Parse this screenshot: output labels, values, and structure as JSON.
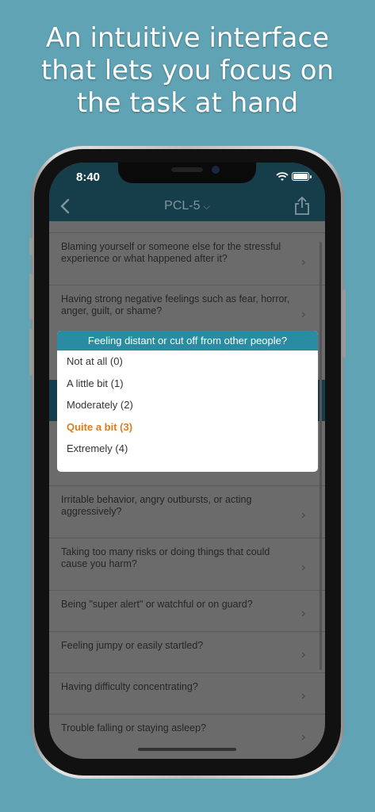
{
  "headline": "An intuitive interface that lets you focus on the task at hand",
  "status_bar": {
    "time": "8:40"
  },
  "nav": {
    "title": "PCL-5",
    "title_chevron": "⌵"
  },
  "list_items": [
    "Blaming yourself or someone else for the stressful experience or what happened after it?",
    "Having strong negative feelings such as fear, horror, anger, guilt, or shame?",
    "Irritable behavior, angry outbursts, or acting aggressively?",
    "Taking too many risks or doing things that could cause you harm?",
    "Being \"super alert\" or watchful or on guard?",
    "Feeling jumpy or easily startled?",
    "Having difficulty concentrating?",
    "Trouble falling or staying asleep?"
  ],
  "modal": {
    "question": "Feeling distant or cut off from other people?",
    "options": [
      {
        "label": "Not at all (0)",
        "selected": false
      },
      {
        "label": "A little bit (1)",
        "selected": false
      },
      {
        "label": "Moderately (2)",
        "selected": false
      },
      {
        "label": "Quite a bit (3)",
        "selected": true
      },
      {
        "label": "Extremely (4)",
        "selected": false
      }
    ]
  },
  "colors": {
    "background": "#5fa3b5",
    "nav_bar": "#163d4a",
    "modal_header": "#2a8ca3",
    "selected_option": "#e07b1c"
  },
  "icons": [
    "back-arrow-icon",
    "chevron-down-icon",
    "share-icon",
    "wifi-icon",
    "battery-icon",
    "chevron-right-icon"
  ]
}
